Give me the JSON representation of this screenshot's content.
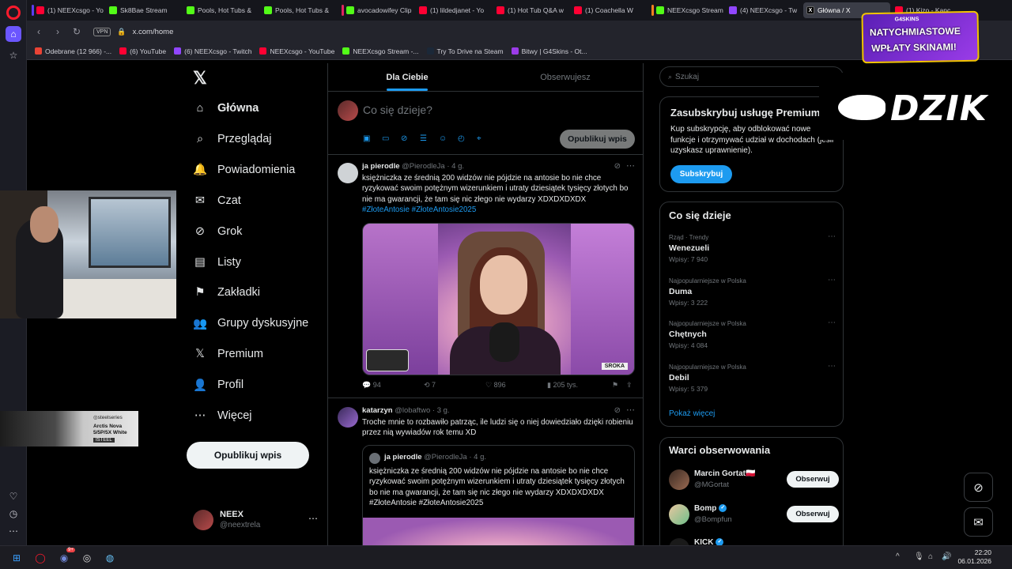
{
  "browser": {
    "tabs": [
      {
        "label": "(1) NEEXcsgo - Yo",
        "color": "#ff0033",
        "mark": "#5b3cf0"
      },
      {
        "label": "Sk8Bae Stream",
        "color": "#53fc18",
        "mark": ""
      },
      {
        "label": "Pools, Hot Tubs &",
        "color": "#53fc18",
        "mark": ""
      },
      {
        "label": "Pools, Hot Tubs &",
        "color": "#53fc18",
        "mark": ""
      },
      {
        "label": "avocadowifey Clip",
        "color": "#53fc18",
        "mark": "#e0245e"
      },
      {
        "label": "(1) lildedjanet - Yo",
        "color": "#ff0033",
        "mark": ""
      },
      {
        "label": "(1) Hot Tub Q&A w",
        "color": "#ff0033",
        "mark": ""
      },
      {
        "label": "(1) Coachella W",
        "color": "#ff0033",
        "mark": ""
      },
      {
        "label": "NEEXcsgo Stream",
        "color": "#53fc18",
        "mark": "#f58220"
      },
      {
        "label": "(4) NEEXcsgo - Tw",
        "color": "#9146ff",
        "mark": ""
      },
      {
        "label": "Główna / X",
        "color": "#000000",
        "mark": "",
        "active": true
      },
      {
        "label": "(1) Kizo - Kanc",
        "color": "#ff0033",
        "mark": ""
      }
    ],
    "url": "x.com/home",
    "vpn": "VPN",
    "bookmarks": [
      {
        "label": "Odebrane (12 966) -...",
        "color": "#ea4335"
      },
      {
        "label": "(6) YouTube",
        "color": "#ff0033"
      },
      {
        "label": "(6) NEEXcsgo - Twitch",
        "color": "#9146ff"
      },
      {
        "label": "NEEXcsgo - YouTube",
        "color": "#ff0033"
      },
      {
        "label": "NEEXcsgo Stream -...",
        "color": "#53fc18"
      },
      {
        "label": "Try To Drive na Steam",
        "color": "#1b2838"
      },
      {
        "label": "Bitwy | G4Skins - Ot...",
        "color": "#9b3ce8"
      }
    ]
  },
  "nav": {
    "logo": "𝕏",
    "items": [
      {
        "label": "Główna",
        "icon": "home-icon",
        "glyph": "⌂",
        "active": true
      },
      {
        "label": "Przeglądaj",
        "icon": "search-icon",
        "glyph": "⌕"
      },
      {
        "label": "Powiadomienia",
        "icon": "bell-icon",
        "glyph": "🔔"
      },
      {
        "label": "Czat",
        "icon": "mail-icon",
        "glyph": "✉"
      },
      {
        "label": "Grok",
        "icon": "grok-icon",
        "glyph": "⊘"
      },
      {
        "label": "Listy",
        "icon": "list-icon",
        "glyph": "▤"
      },
      {
        "label": "Zakładki",
        "icon": "bookmark-icon",
        "glyph": "⚑"
      },
      {
        "label": "Grupy dyskusyjne",
        "icon": "groups-icon",
        "glyph": "👥"
      },
      {
        "label": "Premium",
        "icon": "x-premium-icon",
        "glyph": "𝕏"
      },
      {
        "label": "Profil",
        "icon": "person-icon",
        "glyph": "👤"
      },
      {
        "label": "Więcej",
        "icon": "more-circle-icon",
        "glyph": "⋯"
      }
    ],
    "post_button": "Opublikuj wpis",
    "me": {
      "name": "NEEX",
      "handle": "@neextrela"
    }
  },
  "feed": {
    "tabs": [
      "Dla Ciebie",
      "Obserwujesz"
    ],
    "composer": {
      "placeholder": "Co się dzieje?",
      "button": "Opublikuj wpis"
    },
    "tweets": [
      {
        "name": "ja pierodle",
        "handle": "@PierodleJa",
        "time": "4 g.",
        "text": "księżniczka ze średnią 200 widzów nie pójdzie na antosie bo nie chce ryzykować swoim potężnym wizerunkiem i utraty dziesiątek tysięcy złotych bo nie ma gwarancji, że tam się nic złego nie wydarzy XDXDXDXDX",
        "hashtags": "#ZłoteAntosie #ZłoteAntosie2025",
        "media_badge": "SROKA",
        "replies": "94",
        "retweets": "7",
        "likes": "896",
        "views": "205 tys."
      },
      {
        "name": "katarzyn",
        "handle": "@lobaftwo",
        "time": "3 g.",
        "text": "Troche mnie to rozbawiło patrząc, ile ludzi się o niej dowiedziało dzięki robieniu przez nią wywiadów rok temu XD",
        "quote": {
          "name": "ja pierodle",
          "handle": "@PierodleJa",
          "time": "4 g.",
          "text": "księżniczka ze średnią 200 widzów nie pójdzie na antosie bo nie chce ryzykować swoim potężnym wizerunkiem i utraty dziesiątek tysięcy złotych bo nie ma gwarancji, że tam się nic złego nie wydarzy XDXDXDXDX #ZłoteAntosie #ZłoteAntosie2025"
        }
      }
    ]
  },
  "sidebar": {
    "search_placeholder": "Szukaj",
    "premium": {
      "title": "Zasubskrybuj usługę Premium",
      "text": "Kup subskrypcję, aby odblokować nowe funkcje i otrzymywać udział w dochodach (jeśli uzyskasz uprawnienie).",
      "button": "Subskrybuj"
    },
    "trends": {
      "title": "Co się dzieje",
      "items": [
        {
          "context": "Rząd · Trendy",
          "name": "Wenezueli",
          "posts": "Wpisy: 7 940"
        },
        {
          "context": "Najpopularniejsze w Polska",
          "name": "Duma",
          "posts": "Wpisy: 3 222"
        },
        {
          "context": "Najpopularniejsze w Polska",
          "name": "Chętnych",
          "posts": "Wpisy: 4 084"
        },
        {
          "context": "Najpopularniejsze w Polska",
          "name": "Debil",
          "posts": "Wpisy: 5 379"
        }
      ],
      "more": "Pokaż więcej"
    },
    "who_to_follow": {
      "title": "Warci obserwowania",
      "items": [
        {
          "name": "Marcin Gortat",
          "handle": "@MGortat",
          "button": "Obserwuj",
          "flag": "🇵🇱"
        },
        {
          "name": "Bomp",
          "handle": "@Bompfun",
          "button": "Obserwuj",
          "verified": true
        },
        {
          "name": "KICK",
          "handle": "",
          "button": "",
          "verified": true
        }
      ]
    }
  },
  "overlays": {
    "steelseries": {
      "brand": "◎steelseries",
      "line1": "Arctis Nova",
      "line2": "5/5P/5X White",
      "tag": "ISTEEL"
    },
    "g4skins": {
      "brand": "G4SKINS",
      "line1": "NATYCHMIASTOWE",
      "line2": "WPŁATY SKINAMI!"
    },
    "dzik": "DZIK"
  },
  "taskbar": {
    "time": "22:20",
    "date": "06.01.2026",
    "discord_badge": "9+"
  }
}
